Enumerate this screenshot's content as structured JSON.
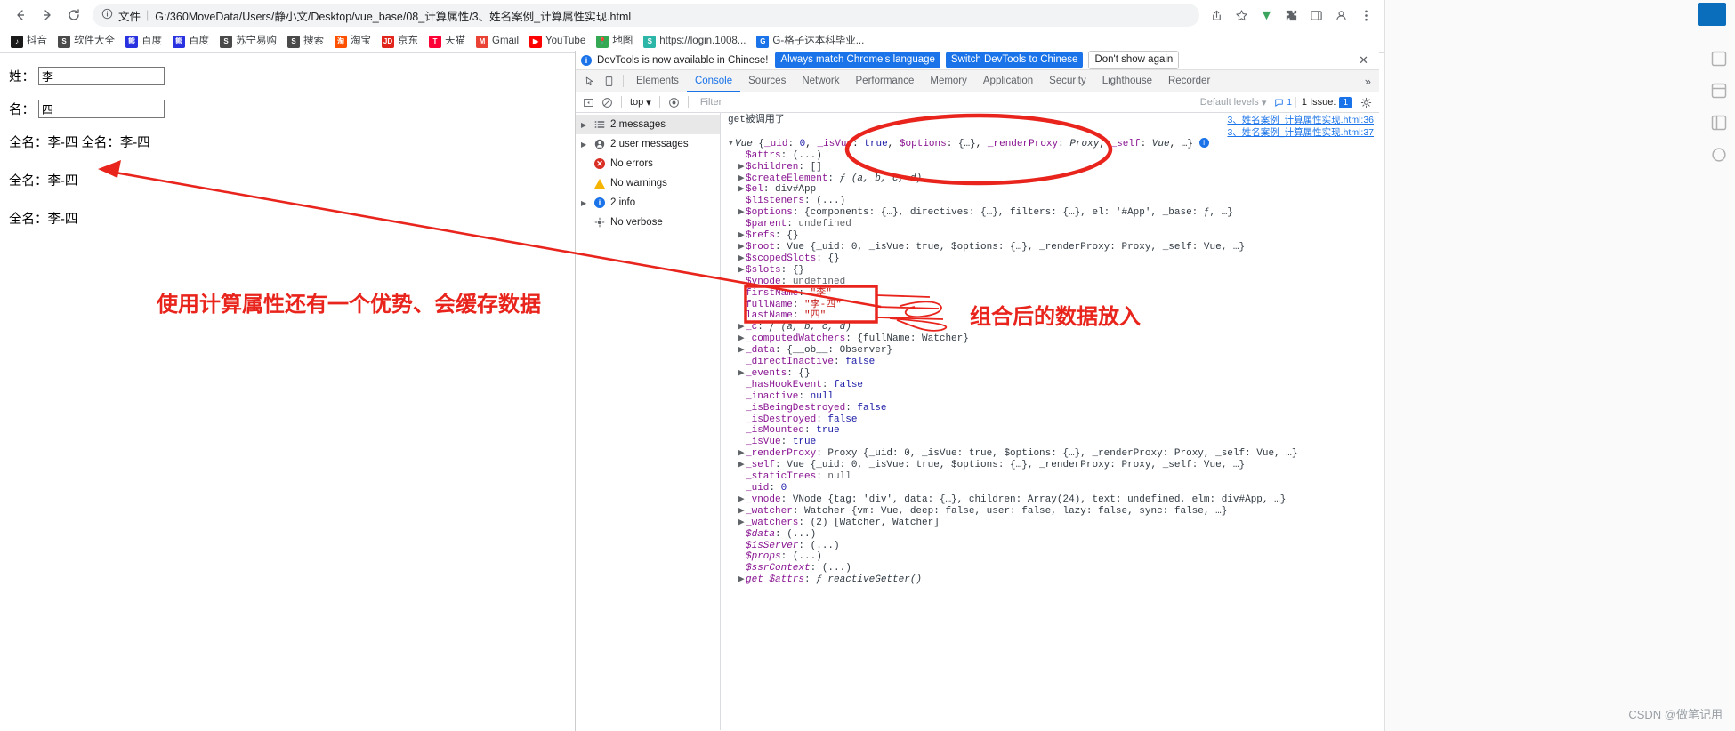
{
  "browser": {
    "nav": {
      "back": "back-arrow",
      "forward": "forward-arrow",
      "reload": "reload"
    },
    "omnibox": {
      "scheme_label": "文件",
      "url": "G:/360MoveData/Users/静小文/Desktop/vue_base/08_计算属性/3、姓名案例_计算属性实现.html"
    },
    "bookmarks": [
      {
        "label": "抖音",
        "letter": "♪",
        "color": "#1a1a1a"
      },
      {
        "label": "软件大全",
        "letter": "S",
        "color": "#4a4a4a"
      },
      {
        "label": "百度",
        "letter": "熊",
        "color": "#2932e1"
      },
      {
        "label": "百度",
        "letter": "熊",
        "color": "#2932e1"
      },
      {
        "label": "苏宁易购",
        "letter": "S",
        "color": "#4a4a4a"
      },
      {
        "label": "搜索",
        "letter": "S",
        "color": "#4a4a4a"
      },
      {
        "label": "淘宝",
        "letter": "淘",
        "color": "#ff5000"
      },
      {
        "label": "京东",
        "letter": "JD",
        "color": "#e1251b"
      },
      {
        "label": "天猫",
        "letter": "T",
        "color": "#ff0036"
      },
      {
        "label": "Gmail",
        "letter": "M",
        "color": "#ea4335"
      },
      {
        "label": "YouTube",
        "letter": "▶",
        "color": "#ff0000"
      },
      {
        "label": "地图",
        "letter": "📍",
        "color": "#34a853"
      },
      {
        "label": "https://login.1008...",
        "letter": "S",
        "color": "#2bb6a8"
      },
      {
        "label": "G-格子达本科毕业...",
        "letter": "G",
        "color": "#1a73e8"
      }
    ]
  },
  "page": {
    "field_surname_label": "姓：",
    "field_surname_value": "李",
    "field_givenname_label": "名：",
    "field_givenname_value": "四",
    "fullname_line_1": "全名：李-四 全名：李-四",
    "fullname_line_2": "全名：李-四",
    "fullname_line_3": "全名：李-四"
  },
  "devtools": {
    "banner": {
      "message": "DevTools is now available in Chinese!",
      "btn_match": "Always match Chrome's language",
      "btn_switch": "Switch DevTools to Chinese",
      "btn_dismiss": "Don't show again",
      "close": "✕"
    },
    "tabs": [
      {
        "label": "Elements",
        "active": false
      },
      {
        "label": "Console",
        "active": true
      },
      {
        "label": "Sources",
        "active": false
      },
      {
        "label": "Network",
        "active": false
      },
      {
        "label": "Performance",
        "active": false
      },
      {
        "label": "Memory",
        "active": false
      },
      {
        "label": "Application",
        "active": false
      },
      {
        "label": "Security",
        "active": false
      },
      {
        "label": "Lighthouse",
        "active": false
      },
      {
        "label": "Recorder",
        "active": false
      }
    ],
    "tabs_overflow": "»",
    "filterbar": {
      "context": "top",
      "filter_placeholder": "Filter",
      "levels": "Default levels",
      "issues_label": "1 Issue:",
      "issues_count": "1",
      "messages_count": "1"
    },
    "sidebar": [
      {
        "label": "2 messages",
        "icon": "list-icon",
        "arrow": true,
        "selected": true
      },
      {
        "label": "2 user messages",
        "icon": "person-icon",
        "arrow": true,
        "selected": false
      },
      {
        "label": "No errors",
        "icon": "error-icon",
        "arrow": false,
        "selected": false
      },
      {
        "label": "No warnings",
        "icon": "warning-icon",
        "arrow": false,
        "selected": false
      },
      {
        "label": "2 info",
        "icon": "info-icon",
        "arrow": true,
        "selected": false
      },
      {
        "label": "No verbose",
        "icon": "verbose-icon",
        "arrow": false,
        "selected": false
      }
    ],
    "source_links": [
      "3、姓名案例_计算属性实现.html:36",
      "3、姓名案例_计算属性实现.html:37"
    ],
    "log_header": "get被调用了",
    "vue_header": "Vue {_uid: 0, _isVue: true, $options: {…}, _renderProxy: Proxy, _self: Vue, …}",
    "properties": [
      {
        "arrow": false,
        "name": "$attrs",
        "sep": ": ",
        "value": "(...)",
        "vtype": "plain"
      },
      {
        "arrow": true,
        "name": "$children",
        "sep": ": ",
        "value": "[]",
        "vtype": "plain"
      },
      {
        "arrow": true,
        "name": "$createElement",
        "sep": ": ",
        "value": "ƒ (a, b, c, d)",
        "vtype": "fn"
      },
      {
        "arrow": true,
        "name": "$el",
        "sep": ": ",
        "value": "div#App",
        "vtype": "plain"
      },
      {
        "arrow": false,
        "name": "$listeners",
        "sep": ": ",
        "value": "(...)",
        "vtype": "plain"
      },
      {
        "arrow": true,
        "name": "$options",
        "sep": ": ",
        "value": "{components: {…}, directives: {…}, filters: {…}, el: '#App', _base: ƒ, …}",
        "vtype": "plain"
      },
      {
        "arrow": false,
        "name": "$parent",
        "sep": ": ",
        "value": "undefined",
        "vtype": "undef"
      },
      {
        "arrow": true,
        "name": "$refs",
        "sep": ": ",
        "value": "{}",
        "vtype": "plain"
      },
      {
        "arrow": true,
        "name": "$root",
        "sep": ": ",
        "value": "Vue {_uid: 0, _isVue: true, $options: {…}, _renderProxy: Proxy, _self: Vue, …}",
        "vtype": "plain"
      },
      {
        "arrow": true,
        "name": "$scopedSlots",
        "sep": ": ",
        "value": "{}",
        "vtype": "plain"
      },
      {
        "arrow": true,
        "name": "$slots",
        "sep": ": ",
        "value": "{}",
        "vtype": "plain"
      },
      {
        "arrow": false,
        "name": "$vnode",
        "sep": ": ",
        "value": "undefined",
        "vtype": "undef"
      },
      {
        "arrow": false,
        "name": "firstName",
        "sep": ": ",
        "value": "\"李\"",
        "vtype": "str"
      },
      {
        "arrow": false,
        "name": "fullName",
        "sep": ": ",
        "value": "\"李-四\"",
        "vtype": "str"
      },
      {
        "arrow": false,
        "name": "lastName",
        "sep": ": ",
        "value": "\"四\"",
        "vtype": "str"
      },
      {
        "arrow": true,
        "name": "_c",
        "sep": ": ",
        "value": "ƒ (a, b, c, d)",
        "vtype": "fn"
      },
      {
        "arrow": true,
        "name": "_computedWatchers",
        "sep": ": ",
        "value": "{fullName: Watcher}",
        "vtype": "plain"
      },
      {
        "arrow": true,
        "name": "_data",
        "sep": ": ",
        "value": "{__ob__: Observer}",
        "vtype": "plain"
      },
      {
        "arrow": false,
        "name": "_directInactive",
        "sep": ": ",
        "value": "false",
        "vtype": "bool"
      },
      {
        "arrow": true,
        "name": "_events",
        "sep": ": ",
        "value": "{}",
        "vtype": "plain"
      },
      {
        "arrow": false,
        "name": "_hasHookEvent",
        "sep": ": ",
        "value": "false",
        "vtype": "bool"
      },
      {
        "arrow": false,
        "name": "_inactive",
        "sep": ": ",
        "value": "null",
        "vtype": "bool"
      },
      {
        "arrow": false,
        "name": "_isBeingDestroyed",
        "sep": ": ",
        "value": "false",
        "vtype": "bool"
      },
      {
        "arrow": false,
        "name": "_isDestroyed",
        "sep": ": ",
        "value": "false",
        "vtype": "bool"
      },
      {
        "arrow": false,
        "name": "_isMounted",
        "sep": ": ",
        "value": "true",
        "vtype": "bool"
      },
      {
        "arrow": false,
        "name": "_isVue",
        "sep": ": ",
        "value": "true",
        "vtype": "bool"
      },
      {
        "arrow": true,
        "name": "_renderProxy",
        "sep": ": ",
        "value": "Proxy {_uid: 0, _isVue: true, $options: {…}, _renderProxy: Proxy, _self: Vue, …}",
        "vtype": "plain"
      },
      {
        "arrow": true,
        "name": "_self",
        "sep": ": ",
        "value": "Vue {_uid: 0, _isVue: true, $options: {…}, _renderProxy: Proxy, _self: Vue, …}",
        "vtype": "plain"
      },
      {
        "arrow": false,
        "name": "_staticTrees",
        "sep": ": ",
        "value": "null",
        "vtype": "undef"
      },
      {
        "arrow": false,
        "name": "_uid",
        "sep": ": ",
        "value": "0",
        "vtype": "num"
      },
      {
        "arrow": true,
        "name": "_vnode",
        "sep": ": ",
        "value": "VNode {tag: 'div', data: {…}, children: Array(24), text: undefined, elm: div#App, …}",
        "vtype": "plain"
      },
      {
        "arrow": true,
        "name": "_watcher",
        "sep": ": ",
        "value": "Watcher {vm: Vue, deep: false, user: false, lazy: false, sync: false, …}",
        "vtype": "plain"
      },
      {
        "arrow": true,
        "name": "_watchers",
        "sep": ": ",
        "value": "(2) [Watcher, Watcher]",
        "vtype": "plain"
      },
      {
        "arrow": false,
        "name": "$data",
        "sep": ": ",
        "value": "(...)",
        "vtype": "plain",
        "getter": true
      },
      {
        "arrow": false,
        "name": "$isServer",
        "sep": ": ",
        "value": "(...)",
        "vtype": "plain",
        "getter": true
      },
      {
        "arrow": false,
        "name": "$props",
        "sep": ": ",
        "value": "(...)",
        "vtype": "plain",
        "getter": true
      },
      {
        "arrow": false,
        "name": "$ssrContext",
        "sep": ": ",
        "value": "(...)",
        "vtype": "plain",
        "getter": true
      },
      {
        "arrow": true,
        "name": "get $attrs",
        "sep": ": ",
        "value": "ƒ reactiveGetter()",
        "vtype": "fn",
        "getter": true
      }
    ]
  },
  "annotations": {
    "note_left": "使用计算属性还有一个优势、会缓存数据",
    "note_right": "组合后的数据放入"
  },
  "watermark": "CSDN @做笔记用",
  "colors": {
    "accent": "#1a73e8",
    "annotation": "#e8241c",
    "error": "#d93025",
    "warning": "#f5b400",
    "string": "#c41a16",
    "propname": "#881391",
    "number": "#1a1aa6"
  }
}
